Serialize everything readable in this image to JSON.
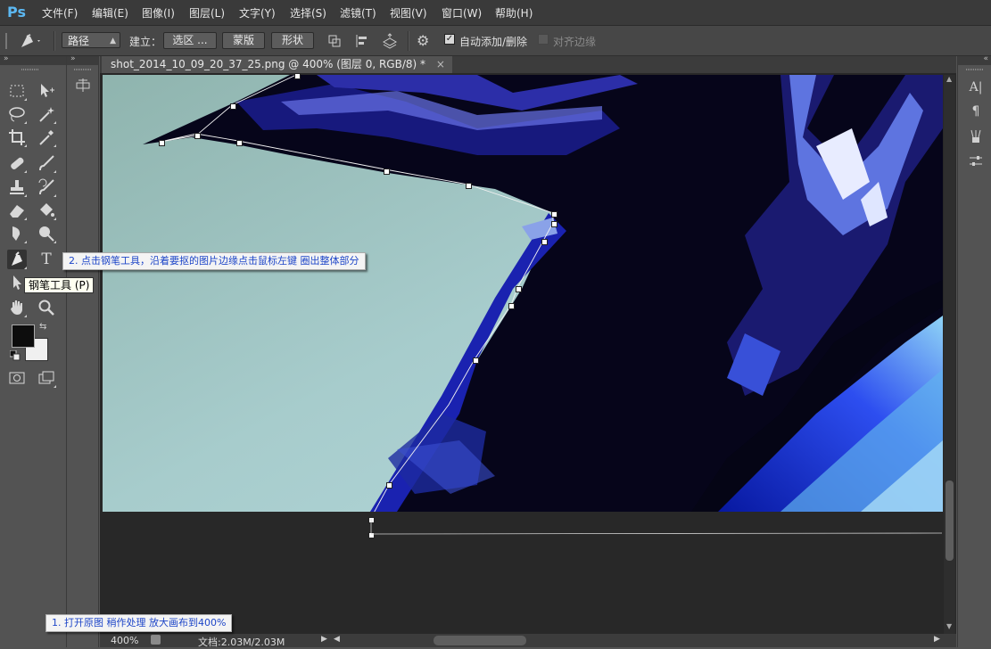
{
  "app": {
    "logo": "Ps"
  },
  "menu": [
    "文件(F)",
    "编辑(E)",
    "图像(I)",
    "图层(L)",
    "文字(Y)",
    "选择(S)",
    "滤镜(T)",
    "视图(V)",
    "窗口(W)",
    "帮助(H)"
  ],
  "options": {
    "mode_value": "路径",
    "build_label": "建立：",
    "btn_selection": "选区 ...",
    "btn_mask": "蒙版",
    "btn_shape": "形状",
    "auto_add_delete_label": "自动添加/删除",
    "auto_add_delete_checked": true,
    "align_edges_label": "对齐边缘",
    "align_edges_checked": false
  },
  "document": {
    "tab_title": "shot_2014_10_09_20_37_25.png @ 400% (图层 0, RGB/8) *",
    "tab_close": "×"
  },
  "tools": {
    "active": "pen-tool",
    "tooltip": "钢笔工具 (P)",
    "type_glyph": "T"
  },
  "annotations": {
    "step1": "1. 打开原图  稍作处理  放大画布到400%",
    "step2": "2. 点击钢笔工具，沿着要抠的图片边缘点击鼠标左键  圈出整体部分"
  },
  "status": {
    "zoom": "400%",
    "doc_info": "文档:2.03M/2.03M"
  },
  "colors": {
    "foreground": "#0d0d0d",
    "background": "#f0f0f0",
    "accent": "#5cb8f2",
    "annotation_text": "#1e46c8"
  },
  "right_panel_icons": [
    "character-icon",
    "paragraph-icon",
    "brush-presets-icon",
    "adjustments-icon"
  ]
}
